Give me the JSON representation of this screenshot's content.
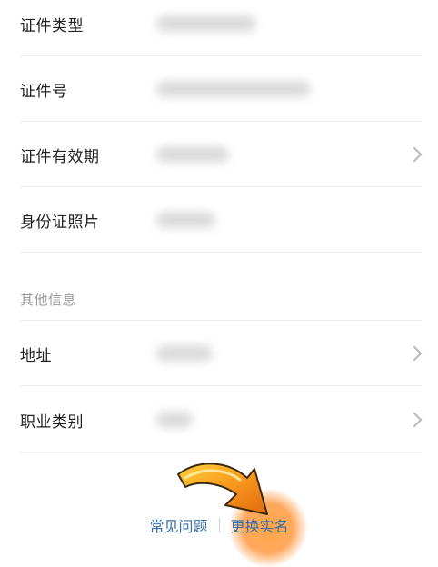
{
  "personal_fields": [
    {
      "label": "证件类型",
      "has_chevron": false
    },
    {
      "label": "证件号",
      "has_chevron": false
    },
    {
      "label": "证件有效期",
      "has_chevron": true
    },
    {
      "label": "身份证照片",
      "has_chevron": false
    }
  ],
  "other_section": {
    "header": "其他信息",
    "fields": [
      {
        "label": "地址",
        "has_chevron": true
      },
      {
        "label": "职业类别",
        "has_chevron": true
      }
    ]
  },
  "footer": {
    "faq_label": "常见问题",
    "change_realname_label": "更换实名"
  },
  "annotation": {
    "arrow_color": "#f28a1a",
    "highlight_color": "#ff9a3c"
  }
}
